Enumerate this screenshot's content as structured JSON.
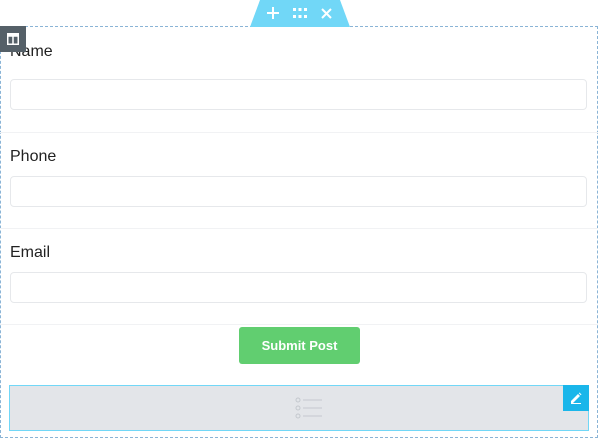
{
  "colors": {
    "accent": "#71d7f7",
    "submit": "#61ce70",
    "column_handle": "#556068",
    "edit_button": "#1ab6ea"
  },
  "section_handle": {
    "icons": [
      "plus-icon",
      "drag-grid-icon",
      "close-icon"
    ]
  },
  "column_handle": {
    "icon": "column-layout-icon"
  },
  "form": {
    "fields": [
      {
        "label": "Name",
        "value": "",
        "placeholder": ""
      },
      {
        "label": "Phone",
        "value": "",
        "placeholder": ""
      },
      {
        "label": "Email",
        "value": "",
        "placeholder": ""
      }
    ],
    "submit_label": "Submit Post"
  },
  "placeholder_widget": {
    "icon": "list-icon",
    "edit_icon": "pencil-icon"
  }
}
